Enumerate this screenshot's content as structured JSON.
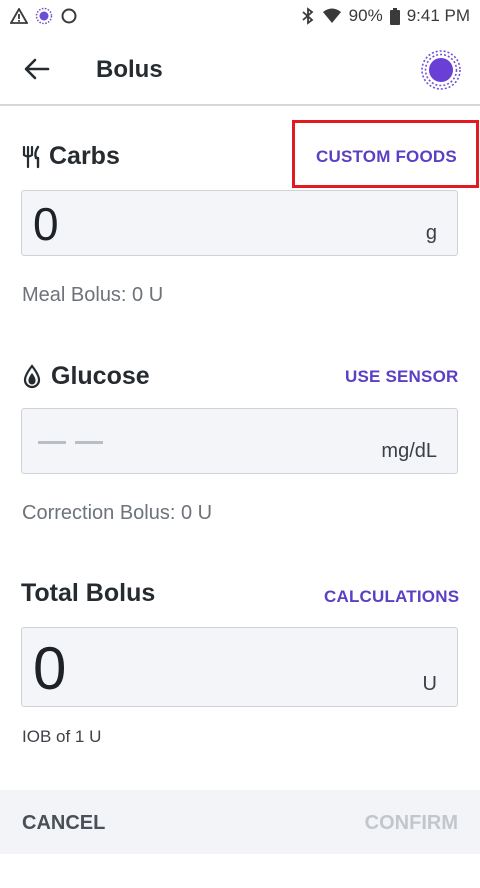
{
  "status_bar": {
    "battery": "90%",
    "time": "9:41 PM",
    "icons": [
      "warning-icon",
      "pod-status-icon",
      "sync-circle-icon",
      "bluetooth-icon",
      "wifi-icon",
      "battery-icon"
    ]
  },
  "app_bar": {
    "title": "Bolus",
    "back_icon": "arrow-left-icon",
    "pod_icon": "pod-icon"
  },
  "carbs": {
    "title": "Carbs",
    "link": "CUSTOM FOODS",
    "value": "0",
    "unit": "g",
    "note": "Meal Bolus: 0 U"
  },
  "glucose": {
    "title": "Glucose",
    "link": "USE SENSOR",
    "unit": "mg/dL",
    "note": "Correction Bolus: 0 U"
  },
  "total": {
    "title": "Total Bolus",
    "link": "CALCULATIONS",
    "value": "0",
    "unit": "U",
    "note": "IOB of 1 U"
  },
  "actions": {
    "cancel": "CANCEL",
    "confirm": "CONFIRM"
  },
  "colors": {
    "accent": "#5b3fc4",
    "highlight": "#e21b23",
    "field_bg": "#f3f5f8"
  }
}
